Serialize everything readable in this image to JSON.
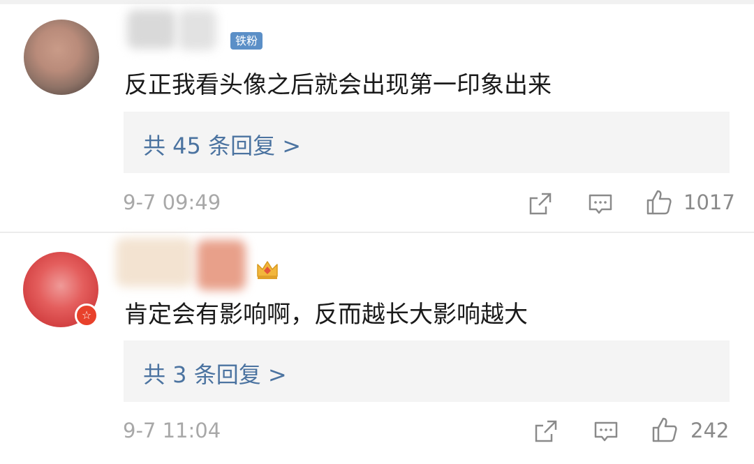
{
  "comments": [
    {
      "badge": "铁粉",
      "text": "反正我看头像之后就会出现第一印象出来",
      "reply_link": "共 45 条回复 >",
      "time": "9-7 09:49",
      "likes": "1017"
    },
    {
      "text": "肯定会有影响啊，反而越长大影响越大",
      "reply_link": "共 3 条回复 >",
      "time": "9-7 11:04",
      "likes": "242"
    }
  ],
  "colors": {
    "link": "#4b73a0",
    "badge_bg": "#5b8fc7",
    "verify_red": "#e8412b",
    "meta_gray": "#a8a8a8"
  },
  "icons": [
    "share-icon",
    "comment-icon",
    "like-icon",
    "crown-icon",
    "verify-icon"
  ]
}
